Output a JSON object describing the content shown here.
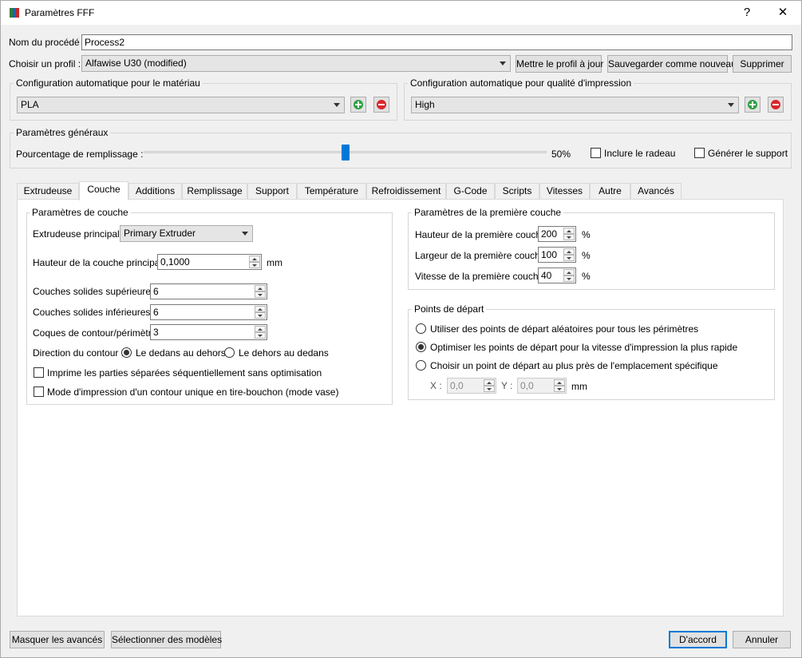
{
  "window": {
    "title": "Paramètres FFF",
    "help_label": "?",
    "close_label": "✕"
  },
  "process": {
    "label": "Nom du procédé :",
    "value": "Process2"
  },
  "profile": {
    "label": "Choisir un profil :",
    "selected": "Alfawise U30 (modified)",
    "update_label": "Mettre le profil à jour",
    "save_new_label": "Sauvegarder comme nouveau",
    "delete_label": "Supprimer"
  },
  "material_auto": {
    "title": "Configuration automatique pour le matériau",
    "selected": "PLA"
  },
  "quality_auto": {
    "title": "Configuration automatique pour qualité d'impression",
    "selected": "High"
  },
  "general": {
    "title": "Paramètres généraux",
    "infill_label": "Pourcentage de remplissage :",
    "infill_value_text": "50%",
    "infill_fraction": 0.5,
    "raft_label": "Inclure le radeau",
    "support_label": "Générer le support"
  },
  "tabs": [
    {
      "label": "Extrudeuse"
    },
    {
      "label": "Couche"
    },
    {
      "label": "Additions"
    },
    {
      "label": "Remplissage"
    },
    {
      "label": "Support"
    },
    {
      "label": "Température"
    },
    {
      "label": "Refroidissement"
    },
    {
      "label": "G-Code"
    },
    {
      "label": "Scripts"
    },
    {
      "label": "Vitesses"
    },
    {
      "label": "Autre"
    },
    {
      "label": "Avancés"
    }
  ],
  "active_tab": "Couche",
  "layer": {
    "title": "Paramètres de couche",
    "primary_extruder_label": "Extrudeuse principale",
    "primary_extruder_value": "Primary Extruder",
    "layer_height_label": "Hauteur de la couche principale",
    "layer_height_value": "0,1000",
    "layer_height_unit": "mm",
    "top_solid_label": "Couches solides supérieures",
    "top_solid_value": "6",
    "bottom_solid_label": "Couches solides inférieures",
    "bottom_solid_value": "6",
    "perimeter_label": "Coques de contour/périmètre",
    "perimeter_value": "3",
    "direction_label": "Direction du contour :",
    "dir_inside_out": "Le dedans au dehors",
    "dir_outside_in": "Le dehors au dedans",
    "sequential_label": "Imprime les parties séparées séquentiellement sans optimisation",
    "vase_label": "Mode d'impression d'un contour unique en tire-bouchon (mode vase)"
  },
  "first_layer": {
    "title": "Paramètres de la première couche",
    "height_label": "Hauteur de la première couche",
    "height_value": "200",
    "width_label": "Largeur de la première couche",
    "width_value": "100",
    "speed_label": "Vitesse de la première couche",
    "speed_value": "40",
    "unit": "%"
  },
  "start_points": {
    "title": "Points de départ",
    "random_label": "Utiliser des points de départ aléatoires pour tous les périmètres",
    "optimize_label": "Optimiser les points de départ pour la vitesse d'impression la plus rapide",
    "closest_label": "Choisir un point de départ au plus près de l'emplacement spécifique",
    "x_label": "X :",
    "x_value": "0,0",
    "y_label": "Y :",
    "y_value": "0,0",
    "unit": "mm"
  },
  "footer": {
    "hide_advanced_label": "Masquer les avancés",
    "select_models_label": "Sélectionner des modèles",
    "ok_label": "D'accord",
    "cancel_label": "Annuler"
  }
}
